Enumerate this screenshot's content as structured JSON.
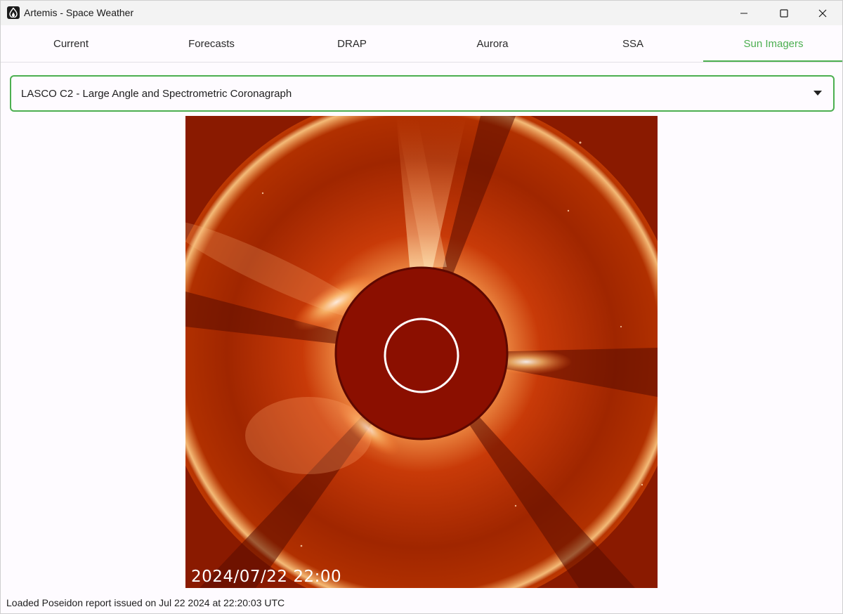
{
  "window": {
    "title": "Artemis - Space Weather"
  },
  "tabs": [
    {
      "label": "Current",
      "active": false
    },
    {
      "label": "Forecasts",
      "active": false
    },
    {
      "label": "DRAP",
      "active": false
    },
    {
      "label": "Aurora",
      "active": false
    },
    {
      "label": "SSA",
      "active": false
    },
    {
      "label": "Sun Imagers",
      "active": true
    }
  ],
  "imager_select": {
    "selected": "LASCO C2 - Large Angle and Spectrometric Coronagraph"
  },
  "image": {
    "timestamp": "2024/07/22 22:00"
  },
  "status": {
    "text": "Loaded Poseidon report issued on Jul 22 2024 at 22:20:03 UTC"
  },
  "colors": {
    "accent": "#4caf50",
    "coronagraph_background": "#8a1a00"
  },
  "icons": {
    "app": "flame-icon",
    "minimize": "minimize-icon",
    "maximize": "maximize-icon",
    "close": "close-icon",
    "dropdown": "caret-down-icon"
  }
}
